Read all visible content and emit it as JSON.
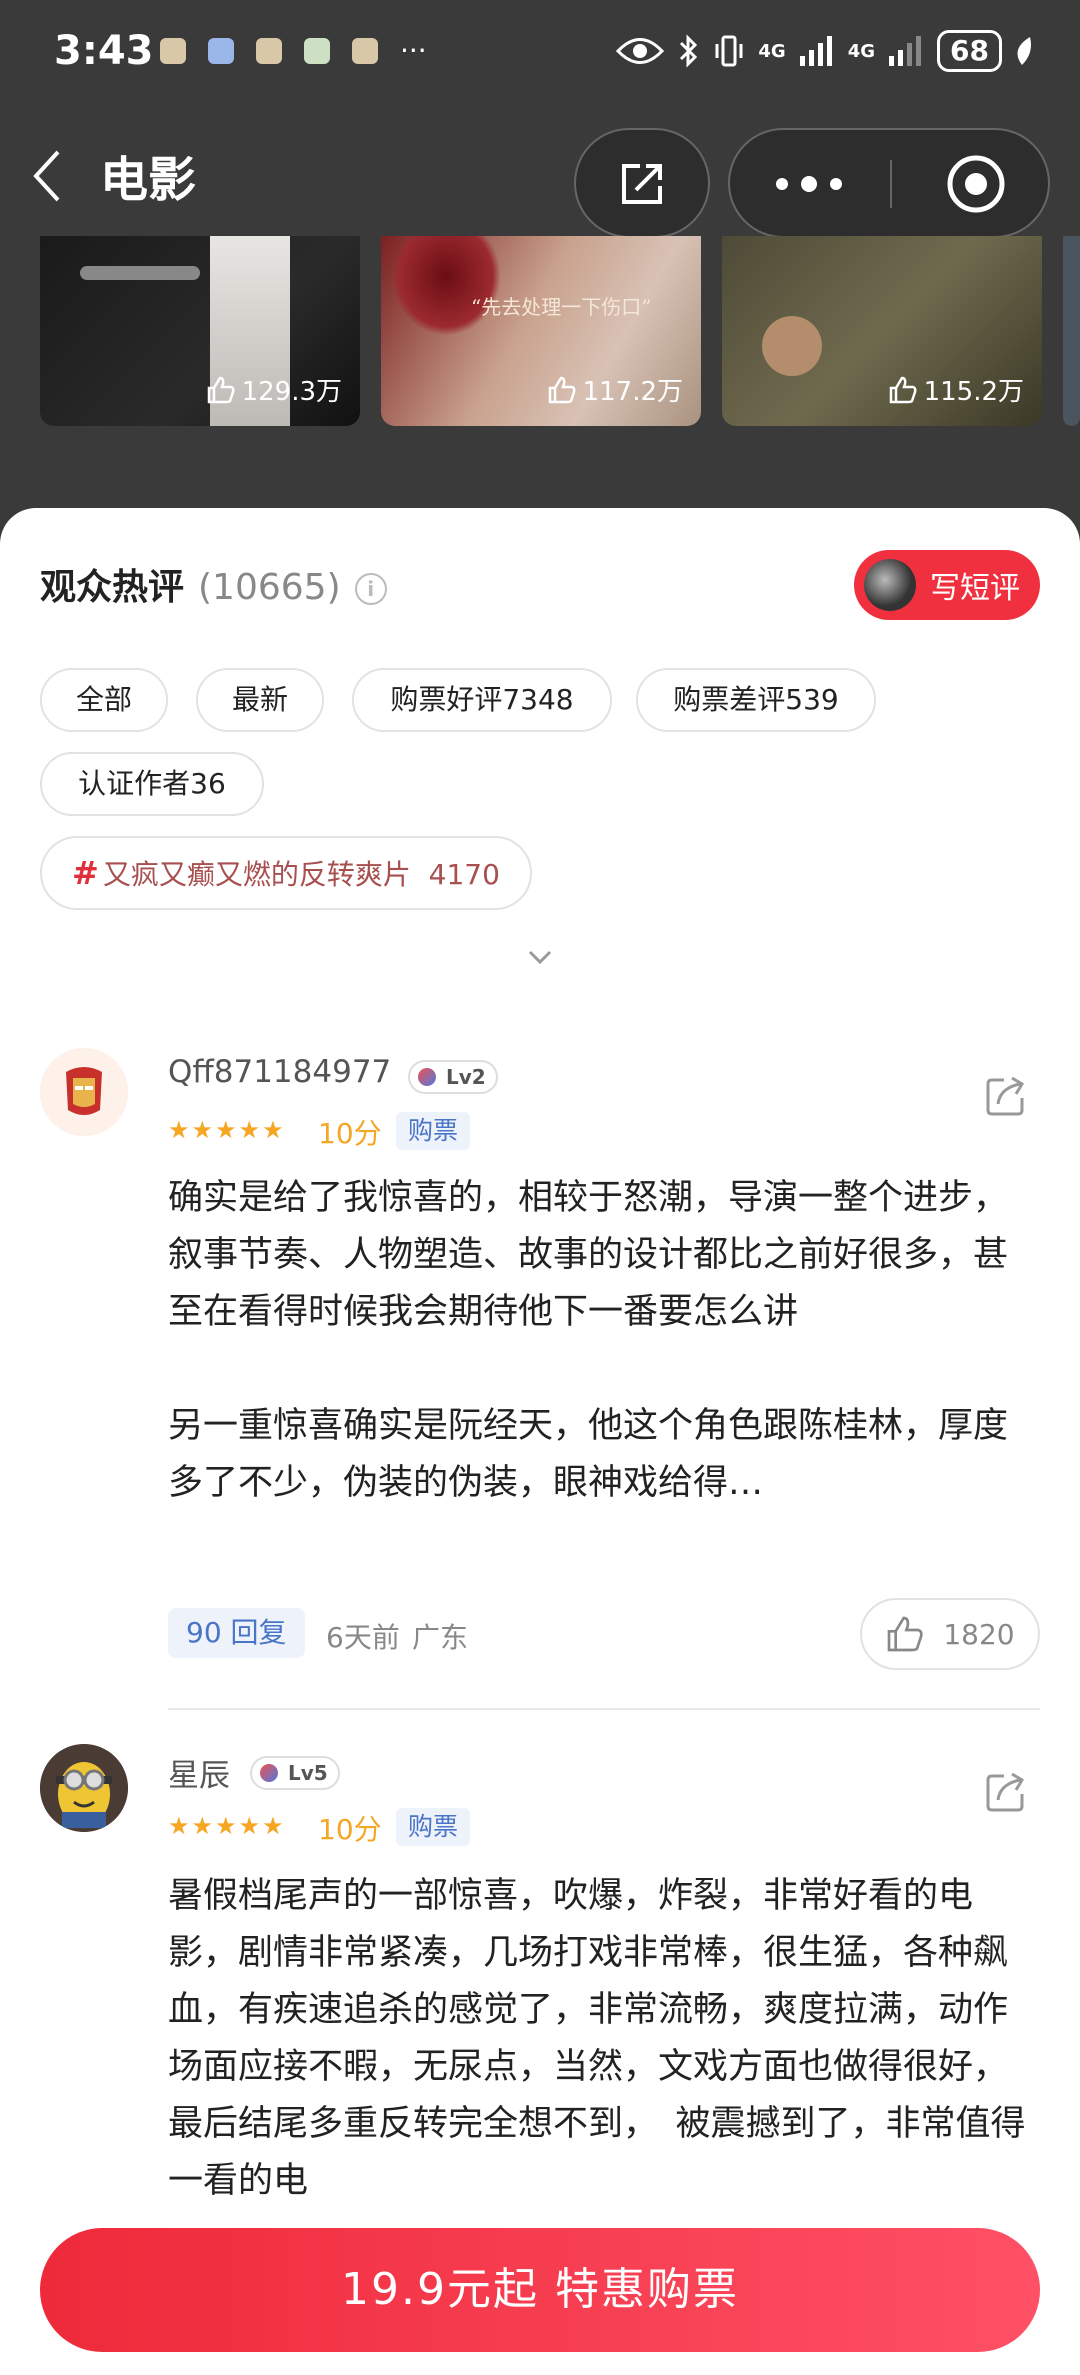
{
  "status_bar": {
    "time": "3:43",
    "more": "···",
    "network1": "4G",
    "network2": "4G",
    "battery": "68"
  },
  "nav": {
    "title": "电影"
  },
  "thumbnails": [
    {
      "likes": "129.3万"
    },
    {
      "likes": "117.2万",
      "caption": "“先去处理一下伤口”"
    },
    {
      "likes": "115.2万"
    }
  ],
  "reviews_section": {
    "title": "观众热评",
    "count": "(10665)",
    "info": "i",
    "write_button": "写短评",
    "filters": [
      "全部",
      "最新",
      "购票好评7348",
      "购票差评539",
      "认证作者36"
    ],
    "topic": {
      "hash": "#",
      "text": "又疯又癫又燃的反转爽片",
      "count": "4170"
    }
  },
  "reviews": [
    {
      "username": "Qff871184977",
      "level": "Lv2",
      "stars": "★★★★★",
      "score": "10分",
      "tag": "购票",
      "content": "确实是给了我惊喜的，相较于怒潮，导演一整个进步，叙事节奏、人物塑造、故事的设计都比之前好很多，甚至在看得时候我会期待他下一番要怎么讲\n\n另一重惊喜确实是阮经天，他这个角色跟陈桂林，厚度多了不少，伪装的伪装，眼神戏给得…",
      "replies": "90 回复",
      "time": "6天前",
      "location": "广东",
      "likes": "1820"
    },
    {
      "username": "星辰",
      "level": "Lv5",
      "stars": "★★★★★",
      "score": "10分",
      "tag": "购票",
      "content": "暑假档尾声的一部惊喜，吹爆，炸裂，非常好看的电影，剧情非常紧凑，几场打戏非常棒，很生猛，各种飙血，有疾速追杀的感觉了，非常流畅，爽度拉满，动作场面应接不暇，无尿点，当然，文戏方面也做得很好，最后结尾多重反转完全想不到，　被震撼到了，非常值得一看的电"
    }
  ],
  "bottom": {
    "buy_button": "19.9元起 特惠购票"
  },
  "colors": {
    "accent": "#f0303f",
    "star": "#f5a623",
    "link": "#4a75c7"
  }
}
